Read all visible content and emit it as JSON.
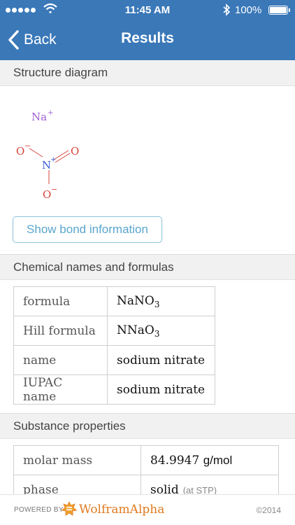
{
  "status_bar": {
    "time": "11:45 AM",
    "battery": "100%"
  },
  "nav": {
    "back_label": "Back",
    "title": "Results"
  },
  "structure": {
    "heading": "Structure diagram",
    "atoms": {
      "sodium": "Na",
      "sodium_charge": "+",
      "nitrogen": "N",
      "nitrogen_charge": "+",
      "oxygen": "O",
      "oxygen_charge": "−"
    },
    "bond_button": "Show bond information"
  },
  "names": {
    "heading": "Chemical names and formulas",
    "rows": [
      {
        "label": "formula",
        "value": "NaNO",
        "sub": "3"
      },
      {
        "label": "Hill formula",
        "value": "NNaO",
        "sub": "3"
      },
      {
        "label": "name",
        "value": "sodium nitrate"
      },
      {
        "label": "IUPAC name",
        "value": "sodium nitrate"
      }
    ]
  },
  "properties": {
    "heading": "Substance properties",
    "rows": [
      {
        "label": "molar mass",
        "value": "84.9947",
        "unit": "g/mol"
      },
      {
        "label": "phase",
        "value": "solid",
        "note": "(at STP)"
      }
    ]
  },
  "footer": {
    "powered_by": "POWERED BY",
    "brand": "WolframAlpha",
    "copyright": "©2014"
  },
  "colors": {
    "nav": "#3a78b8",
    "button_border": "#8cc4dd",
    "button_text": "#5aa6cc",
    "oxygen": "#d9443a",
    "nitrogen": "#3a5fd9",
    "sodium": "#a05fd0",
    "brand": "#e07a20"
  }
}
